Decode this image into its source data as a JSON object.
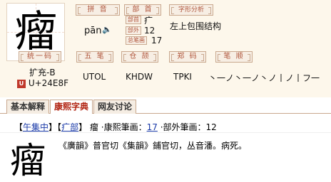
{
  "character": "瘤",
  "pinyin": {
    "label": "拼 音",
    "value": "pān"
  },
  "radical": {
    "label": "部 首",
    "radical": "疒",
    "sub_label_1": "部外",
    "outside_strokes": "12",
    "sub_label_2": "总笔画",
    "total_strokes": "17"
  },
  "structure": {
    "label": "字形分析",
    "value": "左上包围结构"
  },
  "unified_code": {
    "label": "统一码",
    "block": "扩充-B",
    "codepoint": "U+24E8F"
  },
  "wubi": {
    "label": "五 笔",
    "value": "UTOL"
  },
  "cangjie": {
    "label": "仓 颉",
    "value": "KHDW"
  },
  "zhengma": {
    "label": "郑 码",
    "value": "TPKI"
  },
  "stroke_order": {
    "label": "笔 顺",
    "value": "丶一ノ丶一ノ丶ノ丨ノ丨フ一"
  },
  "tabs": [
    "基本解释",
    "康熙字典",
    "网友讨论"
  ],
  "kangxi": {
    "open_bracket": "【",
    "section": "午集中",
    "close_bracket": "】",
    "radical_link": "疒部",
    "char_plain": "瘤",
    "strokes_label": "·康熙筆画：",
    "strokes_value": "17",
    "outside_label": "·部外筆画：",
    "outside_value": "12",
    "definition": "《廣韻》普官切《集韻》鋪官切，丛音潘。病死。"
  }
}
